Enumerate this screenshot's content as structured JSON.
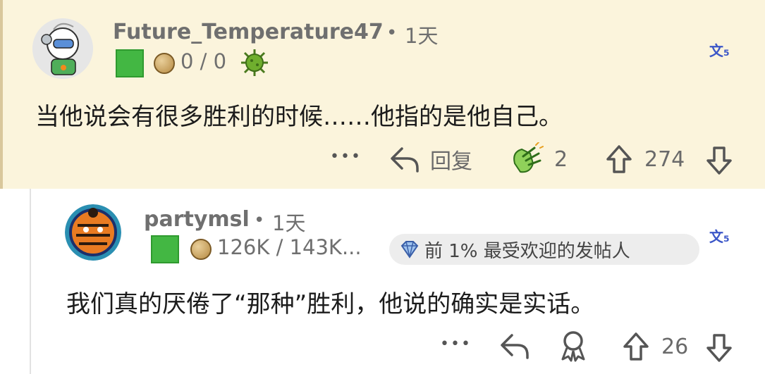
{
  "comments": [
    {
      "username": "Future_Temperature47",
      "separator": "•",
      "time": "1天",
      "karma": "0 / 0",
      "text": "当他说会有很多胜利的时候……他指的是他自己。",
      "actions": {
        "more": "•••",
        "reply_label": "回复",
        "award_count": "2",
        "score": "274"
      },
      "translate_label": "文₅",
      "icons": [
        "avatar-astronaut",
        "green-flair-icon",
        "cookie-icon",
        "virus-icon",
        "more-icon",
        "reply-arrow-icon",
        "award-hands-icon",
        "upvote-icon",
        "downvote-icon",
        "translate-icon"
      ]
    },
    {
      "username": "partymsl",
      "separator": "•",
      "time": "1天",
      "karma": "126K / 143K...",
      "badge": "前 1% 最受欢迎的发帖人",
      "text": "我们真的厌倦了“那种”胜利，他说的确实是实话。",
      "actions": {
        "more": "•••",
        "score": "26"
      },
      "translate_label": "文₅",
      "icons": [
        "avatar-tiger",
        "green-flair-icon",
        "cookie-icon",
        "diamond-badge-icon",
        "more-icon",
        "reply-arrow-icon",
        "award-icon",
        "upvote-icon",
        "downvote-icon",
        "translate-icon"
      ]
    }
  ],
  "colors": {
    "highlight_bg": "#fbf4dc",
    "meta_text": "#6f6f6f",
    "accent_blue": "#3b56c8",
    "flair_green": "#43b743"
  }
}
